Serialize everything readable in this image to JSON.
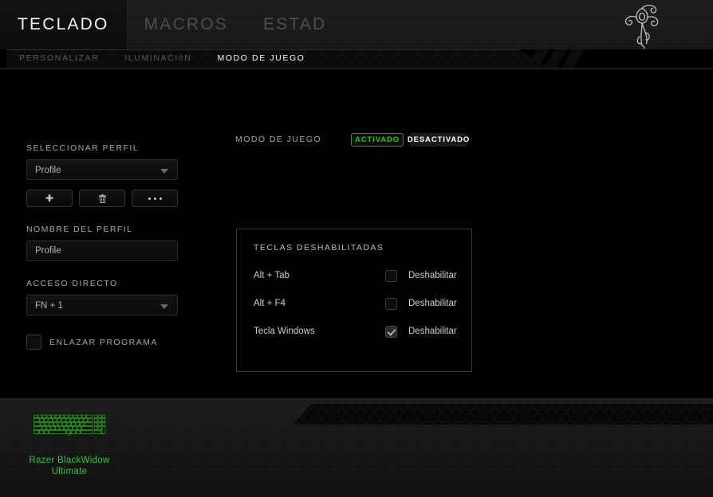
{
  "app": {
    "brand_logo": "razer-triple-snake-logo",
    "accent_green": "#2fc21e",
    "device_green": "#39c43a"
  },
  "header": {
    "tabs": [
      {
        "label": "TECLADO",
        "active": true
      },
      {
        "label": "MACROS",
        "active": false
      },
      {
        "label": "ESTAD",
        "active": false
      }
    ]
  },
  "subnav": {
    "items": [
      {
        "label": "PERSONALIZAR",
        "active": false
      },
      {
        "label": "ILUMINACIóN",
        "active": false
      },
      {
        "label": "MODO DE JUEGO",
        "active": true
      }
    ]
  },
  "profile_panel": {
    "select_profile_label": "SELECCIONAR PERFIL",
    "profile_select_value": "Profile",
    "buttons": [
      {
        "name": "add-profile-button",
        "icon": "plus-icon"
      },
      {
        "name": "delete-profile-button",
        "icon": "trash-icon"
      },
      {
        "name": "more-options-button",
        "icon": "ellipsis-icon"
      }
    ],
    "profile_name_label": "NOMBRE DEL PERFIL",
    "profile_name_value": "Profile",
    "profile_name_placeholder": "Profile",
    "shortcut_label": "ACCESO DIRECTO",
    "shortcut_value": "FN + 1",
    "link_program_label": "ENLAZAR PROGRAMA",
    "link_program_checked": false
  },
  "game_mode": {
    "title": "MODO DE JUEGO",
    "toggle_on_label": "ACTIVADO",
    "toggle_off_label": "DESACTIVADO",
    "toggle_state": "on",
    "disabled_keys_title": "TECLAS DESHABILITADAS",
    "rows": [
      {
        "key": "Alt + Tab",
        "action_label": "Deshabilitar",
        "checked": false
      },
      {
        "key": "Alt + F4",
        "action_label": "Deshabilitar",
        "checked": false
      },
      {
        "key": "Tecla Windows",
        "action_label": "Deshabilitar",
        "checked": true
      }
    ]
  },
  "device_bar": {
    "device_image": "razer-blackwidow-keyboard-thumbnail",
    "device_name_line1": "Razer BlackWidow",
    "device_name_line2": "Ultimate"
  }
}
